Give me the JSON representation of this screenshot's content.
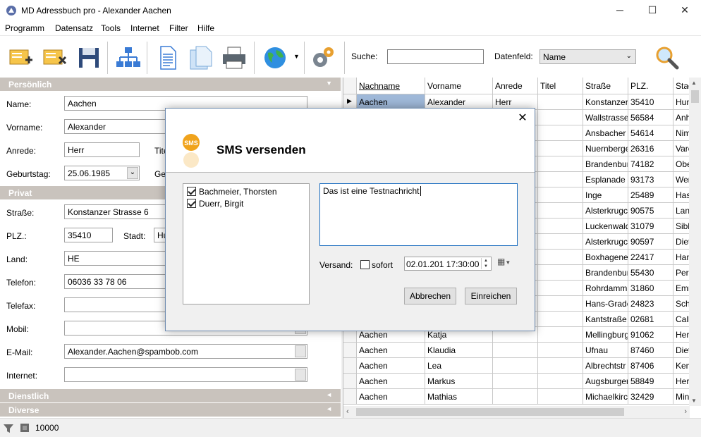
{
  "window": {
    "title": "MD Adressbuch pro - Alexander Aachen",
    "minimize": "─",
    "maximize": "☐",
    "close": "✕"
  },
  "menu": [
    "Programm",
    "Datensatz",
    "Tools",
    "Internet",
    "Filter",
    "Hilfe"
  ],
  "toolbar": {
    "search_label": "Suche:",
    "search_value": "",
    "field_label": "Datenfeld:",
    "field_value": "Name",
    "icons": [
      "new-record-icon",
      "delete-record-icon",
      "save-icon",
      "hierarchy-icon",
      "document-icon",
      "copy-document-icon",
      "printer-icon",
      "globe-icon",
      "settings-icon",
      "search-icon"
    ]
  },
  "form": {
    "sections": {
      "persoenlich": "Persönlich",
      "privat": "Privat",
      "dienstlich": "Dienstlich",
      "diverse": "Diverse"
    },
    "labels": {
      "name": "Name:",
      "vorname": "Vorname:",
      "anrede": "Anrede:",
      "titel": "Titel",
      "geburtstag": "Geburtstag:",
      "geschlecht": "Ges",
      "strasse": "Straße:",
      "plz": "PLZ.:",
      "stadt": "Stadt:",
      "land": "Land:",
      "telefon": "Telefon:",
      "telefax": "Telefax:",
      "mobil": "Mobil:",
      "email": "E-Mail:",
      "internet": "Internet:"
    },
    "values": {
      "name": "Aachen",
      "vorname": "Alexander",
      "anrede": "Herr",
      "geburtstag": "25.06.1985",
      "strasse": "Konstanzer Strasse 6",
      "plz": "35410",
      "stadt": "Hu",
      "land": "HE",
      "telefon": "06036 33 78 06",
      "telefax": "",
      "mobil": "",
      "email": "Alexander.Aachen@spambob.com",
      "internet": ""
    }
  },
  "grid": {
    "columns": [
      "Nachname",
      "Vorname",
      "Anrede",
      "Titel",
      "Straße",
      "PLZ.",
      "Stad"
    ],
    "rows": [
      [
        "Aachen",
        "Alexander",
        "Herr",
        "",
        "Konstanzer",
        "35410",
        "Hun"
      ],
      [
        "",
        "",
        "",
        "",
        "Wallstrasse",
        "56584",
        "Anh"
      ],
      [
        "",
        "",
        "",
        "",
        "Ansbacher",
        "54614",
        "Nims"
      ],
      [
        "",
        "",
        "",
        "",
        "Nuernberge",
        "26316",
        "Vare"
      ],
      [
        "",
        "",
        "",
        "",
        "Brandenbur",
        "74182",
        "Obe"
      ],
      [
        "",
        "",
        "",
        "",
        "Esplanade",
        "93173",
        "Wer"
      ],
      [
        "",
        "",
        "",
        "",
        "Inge",
        "25489",
        "Hase"
      ],
      [
        "",
        "",
        "",
        "",
        "Alsterkrugc",
        "90575",
        "Lang"
      ],
      [
        "",
        "",
        "",
        "",
        "Luckenwald",
        "31079",
        "Sibb"
      ],
      [
        "",
        "",
        "",
        "",
        "Alsterkrugc",
        "90597",
        "Diet"
      ],
      [
        "",
        "",
        "",
        "",
        "Boxhagener",
        "22417",
        "Ham"
      ],
      [
        "",
        "",
        "",
        "",
        "Brandenbur",
        "55430",
        "Pers"
      ],
      [
        "",
        "",
        "",
        "",
        "Rohrdamm",
        "31860",
        "Emm"
      ],
      [
        "",
        "",
        "",
        "",
        "Hans-Grade",
        "24823",
        "Schl"
      ],
      [
        "",
        "",
        "",
        "",
        "Kantstraße",
        "02681",
        "Calle"
      ],
      [
        "Aachen",
        "Katja",
        "",
        "",
        "Mellingburgr",
        "91062",
        "Herz"
      ],
      [
        "Aachen",
        "Klaudia",
        "",
        "",
        "Ufnau",
        "87460",
        "Diet"
      ],
      [
        "Aachen",
        "Lea",
        "",
        "",
        "Albrechtstr",
        "87406",
        "Kem"
      ],
      [
        "Aachen",
        "Markus",
        "",
        "",
        "Augsburger",
        "58849",
        "Hers"
      ],
      [
        "Aachen",
        "Mathias",
        "",
        "",
        "Michaelkirch",
        "32429",
        "Minc"
      ]
    ]
  },
  "status": {
    "count": "10000"
  },
  "dialog": {
    "icon_text": "SMS",
    "title": "SMS versenden",
    "recipients": [
      {
        "name": "Bachmeier, Thorsten",
        "checked": true
      },
      {
        "name": "Duerr, Birgit",
        "checked": true
      }
    ],
    "message": "Das ist eine Testnachricht",
    "versand_label": "Versand:",
    "sofort_label": "sofort",
    "sofort_checked": false,
    "datetime": "02.01.201 17:30:00",
    "cancel": "Abbrechen",
    "submit": "Einreichen"
  },
  "colors": {
    "section_header": "#c9c3bd",
    "selected_cell": "#9fb8d8",
    "dialog_border": "#6e8bb0",
    "sms_icon": "#f0a31c"
  }
}
